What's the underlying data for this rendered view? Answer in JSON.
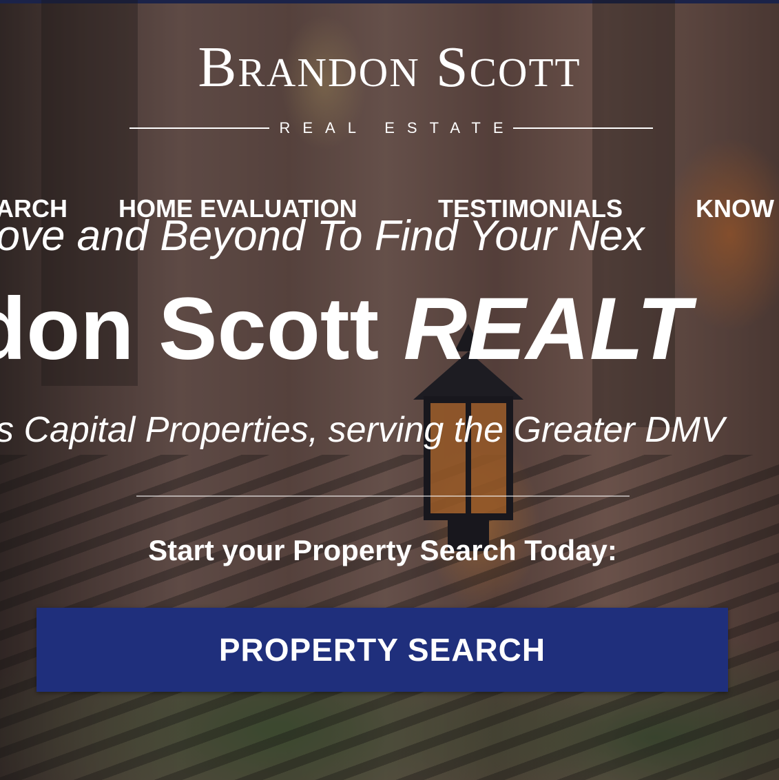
{
  "brand": {
    "name": "Brandon Scott",
    "subtitle": "REAL ESTATE"
  },
  "nav": {
    "items": [
      {
        "label": "ARCH"
      },
      {
        "label": "HOME EVALUATION"
      },
      {
        "label": "TESTIMONIALS"
      },
      {
        "label": "KNOW"
      }
    ]
  },
  "hero": {
    "tagline": "bove and Beyond To Find Your Nex",
    "headline_plain": "don Scott ",
    "headline_italic": "REALT",
    "subline": "s Capital Properties, serving the Greater DMV",
    "cta_text": "Start your Property Search Today:",
    "cta_button": "PROPERTY SEARCH"
  },
  "colors": {
    "accent": "#1f2f7c",
    "top_bar": "#1e2a5e",
    "text": "#ffffff"
  }
}
